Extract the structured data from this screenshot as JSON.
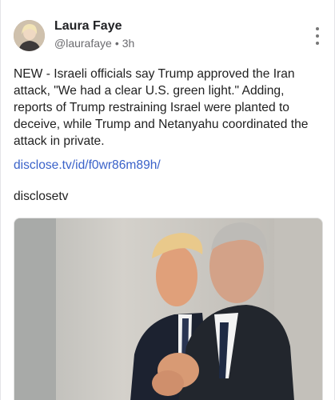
{
  "post": {
    "author_name": "Laura Faye",
    "handle": "@laurafaye",
    "separator": "•",
    "time": "3h",
    "more_icon": "vertical-ellipsis-icon",
    "text": "NEW - Israeli officials say Trump approved the Iran attack, \"We had a clear U.S. green light.\" Adding, reports of Trump restraining Israel were planted to deceive, while Trump and Netanyahu coordinated the attack in private.",
    "link": "disclose.tv/id/f0wr86m89h/",
    "source": "disclosetv"
  },
  "colors": {
    "link": "#3a62c9",
    "meta": "#6b6b6f",
    "text": "#1f1f1f"
  }
}
